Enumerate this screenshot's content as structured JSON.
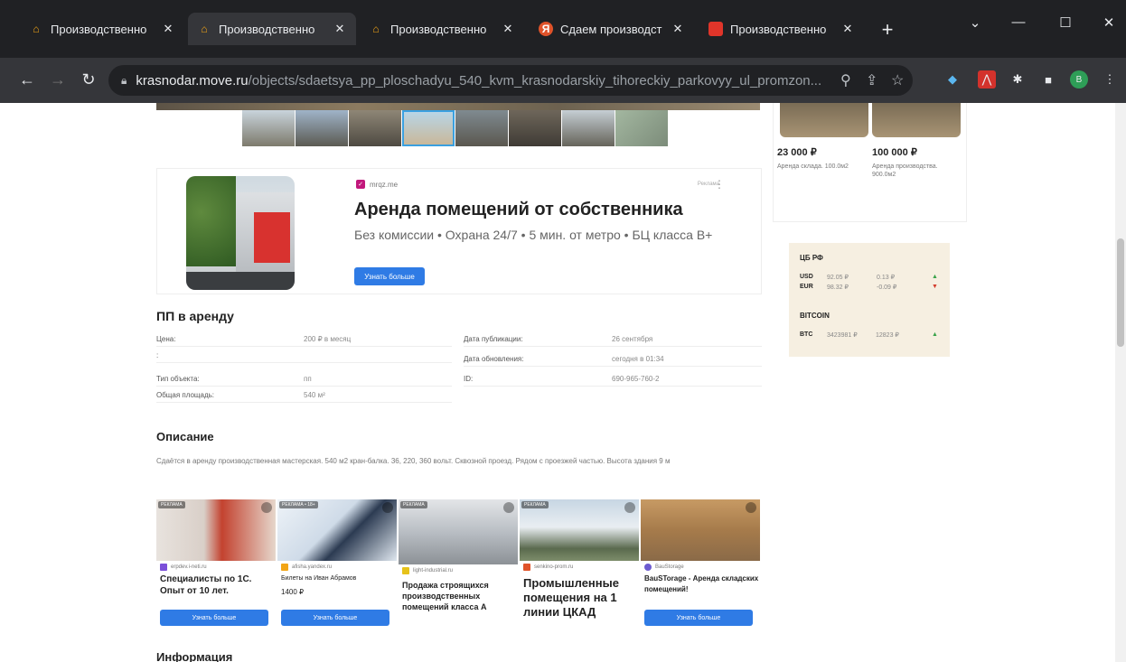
{
  "tabs": [
    {
      "title": "Производственно",
      "active": false
    },
    {
      "title": "Производственно",
      "active": true
    },
    {
      "title": "Производственно",
      "active": false
    },
    {
      "title": "Сдаем производст",
      "active": false
    },
    {
      "title": "Производственно",
      "active": false
    }
  ],
  "address": {
    "host": "krasnodar.move.ru",
    "path": "/objects/sdaetsya_pp_ploschadyu_540_kvm_krasnodarskiy_tihoreckiy_parkovyy_ul_promzon..."
  },
  "profile_initial": "B",
  "ad": {
    "source": "mrqz.me",
    "reklama": "Реклама",
    "title": "Аренда помещений от собственника",
    "subtitle": "Без комиссии • Охрана 24/7 • 5 мин. от метро • БЦ класса В+",
    "button": "Узнать больше"
  },
  "listing": {
    "heading": "ПП в аренду",
    "left": [
      {
        "key": "Цена:",
        "value": "200 ₽ в месяц"
      },
      {
        "key": ":",
        "value": ""
      },
      {
        "key": "Тип объекта:",
        "value": "пп"
      },
      {
        "key": "Общая площадь:",
        "value": "540 м²"
      }
    ],
    "right": [
      {
        "key": "Дата публикации:",
        "value": "26 сентября"
      },
      {
        "key": "Дата обновления:",
        "value": "сегодня в 01:34"
      },
      {
        "key": "ID:",
        "value": "690-965-760-2"
      }
    ]
  },
  "description": {
    "heading": "Описание",
    "text": "Сдаётся в аренду производственная мастерская. 540 м2 кран-балка. 36, 220, 360 вольт. Сквозной проезд. Рядом с проезжей частью. Высота здания 9 м"
  },
  "cards": [
    {
      "tag": "РЕКЛАМА",
      "source": "erpdev.i-neti.ru",
      "title": "Специалисты по 1С. Опыт от 10 лет.",
      "button": "Узнать больше",
      "srcColor": "#7b4fd9"
    },
    {
      "tag": "РЕКЛАМА • 18+",
      "source": "afisha.yandex.ru",
      "title": "Билеты на Иван Абрамов",
      "price": "1400 ₽",
      "button": "Узнать больше",
      "srcColor": "#f2a516"
    },
    {
      "tag": "РЕКЛАМА",
      "source": "light-industrial.ru",
      "title": "Продажа строящихся производственных помещений класса А",
      "button": "",
      "srcColor": "#e6c21a"
    },
    {
      "tag": "РЕКЛАМА",
      "source": "senkino-prom.ru",
      "title": "Промышленные помещения на 1 линии ЦКАД",
      "button": "",
      "srcColor": "#e0532a"
    },
    {
      "tag": "",
      "source": "BauStorage",
      "title": "BauSTorage - Аренда складских помещений!",
      "button": "Узнать больше",
      "srcColor": "#6d5bd0"
    }
  ],
  "info_heading": "Информация",
  "side": [
    {
      "price": "23 000 ₽",
      "desc": "Аренда склада. 100.0м2"
    },
    {
      "price": "100 000 ₽",
      "desc": "Аренда производства. 900.0м2"
    }
  ],
  "fx": {
    "heading": "ЦБ РФ",
    "rows": [
      {
        "code": "USD",
        "value": "92.05 ₽",
        "change": "0.13 ₽",
        "dir": "▲"
      },
      {
        "code": "EUR",
        "value": "98.32 ₽",
        "change": "-0.09 ₽",
        "dir": "▼"
      }
    ],
    "crypto_heading": "BITCOIN",
    "crypto": {
      "code": "BTC",
      "value": "3423981 ₽",
      "change": "12823 ₽",
      "dir": "▲"
    }
  }
}
